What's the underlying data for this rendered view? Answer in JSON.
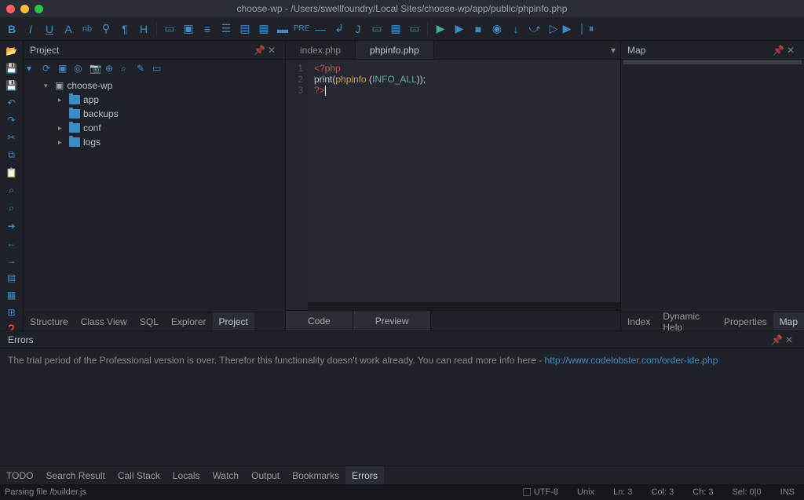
{
  "title": "choose-wp - /Users/swellfoundry/Local Sites/choose-wp/app/public/phpinfo.php",
  "project_panel_title": "Project",
  "map_panel_title": "Map",
  "tree": {
    "root": "choose-wp",
    "items": [
      "app",
      "backups",
      "conf",
      "logs"
    ]
  },
  "editor_tabs": {
    "inactive": "index.php",
    "active": "phpinfo.php"
  },
  "code": {
    "lines": [
      "1",
      "2",
      "3"
    ],
    "l1_open": "<?php",
    "l2_print": "print",
    "l2_phpinfo": "phpinfo",
    "l2_const": "INFO_ALL",
    "l3_close": "?>"
  },
  "view_tabs": [
    "Code",
    "Preview"
  ],
  "left_tabs": [
    "Structure",
    "Class View",
    "SQL",
    "Explorer",
    "Project"
  ],
  "right_tabs": [
    "Index",
    "Dynamic Help",
    "Properties",
    "Map"
  ],
  "errors": {
    "title": "Errors",
    "message_prefix": "The trial period of the Professional version is over. Therefor this functionality doesn't work already. You can read more info here - ",
    "link": "http://www.codelobster.com/order-ide.php"
  },
  "bottom_tabs": [
    "TODO",
    "Search Result",
    "Call Stack",
    "Locals",
    "Watch",
    "Output",
    "Bookmarks",
    "Errors"
  ],
  "status": {
    "left": "Parsing file /builder.js",
    "encoding": "UTF-8",
    "eol": "Unix",
    "ln": "Ln:  3",
    "col": "Col:  3",
    "ch": "Ch:  3",
    "sel": "Sel: 0|0",
    "ins": "INS"
  }
}
